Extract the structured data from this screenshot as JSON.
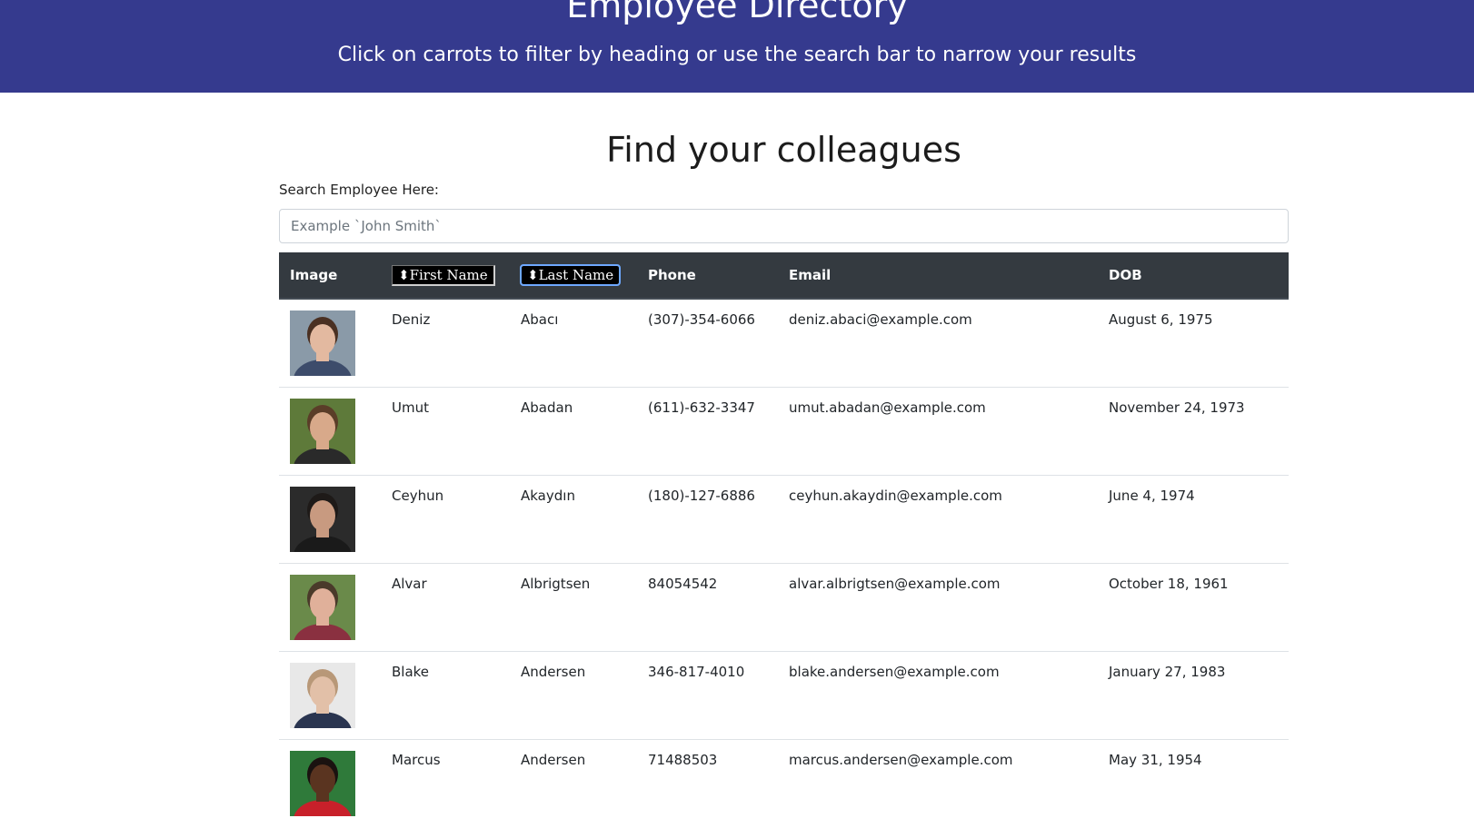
{
  "banner": {
    "title": "Employee Directory",
    "subtitle": "Click on carrots to filter by heading or use the search bar to narrow your results"
  },
  "main": {
    "title": "Find your colleagues",
    "search_label": "Search Employee Here:",
    "search_placeholder": "Example `John Smith`"
  },
  "table": {
    "headers": {
      "image": "Image",
      "first_name": "⬍First Name",
      "last_name": "⬍Last Name",
      "phone": "Phone",
      "email": "Email",
      "dob": "DOB"
    },
    "rows": [
      {
        "first": "Deniz",
        "last": "Abacı",
        "phone": "(307)-354-6066",
        "email": "deniz.abaci@example.com",
        "dob": "August 6, 1975",
        "avatar": {
          "bg": "#8a9aa8",
          "skin": "#e3b9a0",
          "hair": "#4a3022",
          "shirt": "#3d4c6b"
        }
      },
      {
        "first": "Umut",
        "last": "Abadan",
        "phone": "(611)-632-3347",
        "email": "umut.abadan@example.com",
        "dob": "November 24, 1973",
        "avatar": {
          "bg": "#5e7a3a",
          "skin": "#d8a98a",
          "hair": "#5a3d28",
          "shirt": "#2a2a2a"
        }
      },
      {
        "first": "Ceyhun",
        "last": "Akaydın",
        "phone": "(180)-127-6886",
        "email": "ceyhun.akaydin@example.com",
        "dob": "June 4, 1974",
        "avatar": {
          "bg": "#2b2b2b",
          "skin": "#c89a80",
          "hair": "#1e1a18",
          "shirt": "#1a1a1a"
        }
      },
      {
        "first": "Alvar",
        "last": "Albrigtsen",
        "phone": "84054542",
        "email": "alvar.albrigtsen@example.com",
        "dob": "October 18, 1961",
        "avatar": {
          "bg": "#6a8a4a",
          "skin": "#e0b09a",
          "hair": "#4a3a2a",
          "shirt": "#8a3040"
        }
      },
      {
        "first": "Blake",
        "last": "Andersen",
        "phone": "346-817-4010",
        "email": "blake.andersen@example.com",
        "dob": "January 27, 1983",
        "avatar": {
          "bg": "#e8e8e8",
          "skin": "#e2c0a8",
          "hair": "#b89878",
          "shirt": "#2a3550"
        }
      },
      {
        "first": "Marcus",
        "last": "Andersen",
        "phone": "71488503",
        "email": "marcus.andersen@example.com",
        "dob": "May 31, 1954",
        "avatar": {
          "bg": "#2f7a3a",
          "skin": "#5a3420",
          "hair": "#1a1210",
          "shirt": "#c8202a"
        }
      }
    ]
  }
}
